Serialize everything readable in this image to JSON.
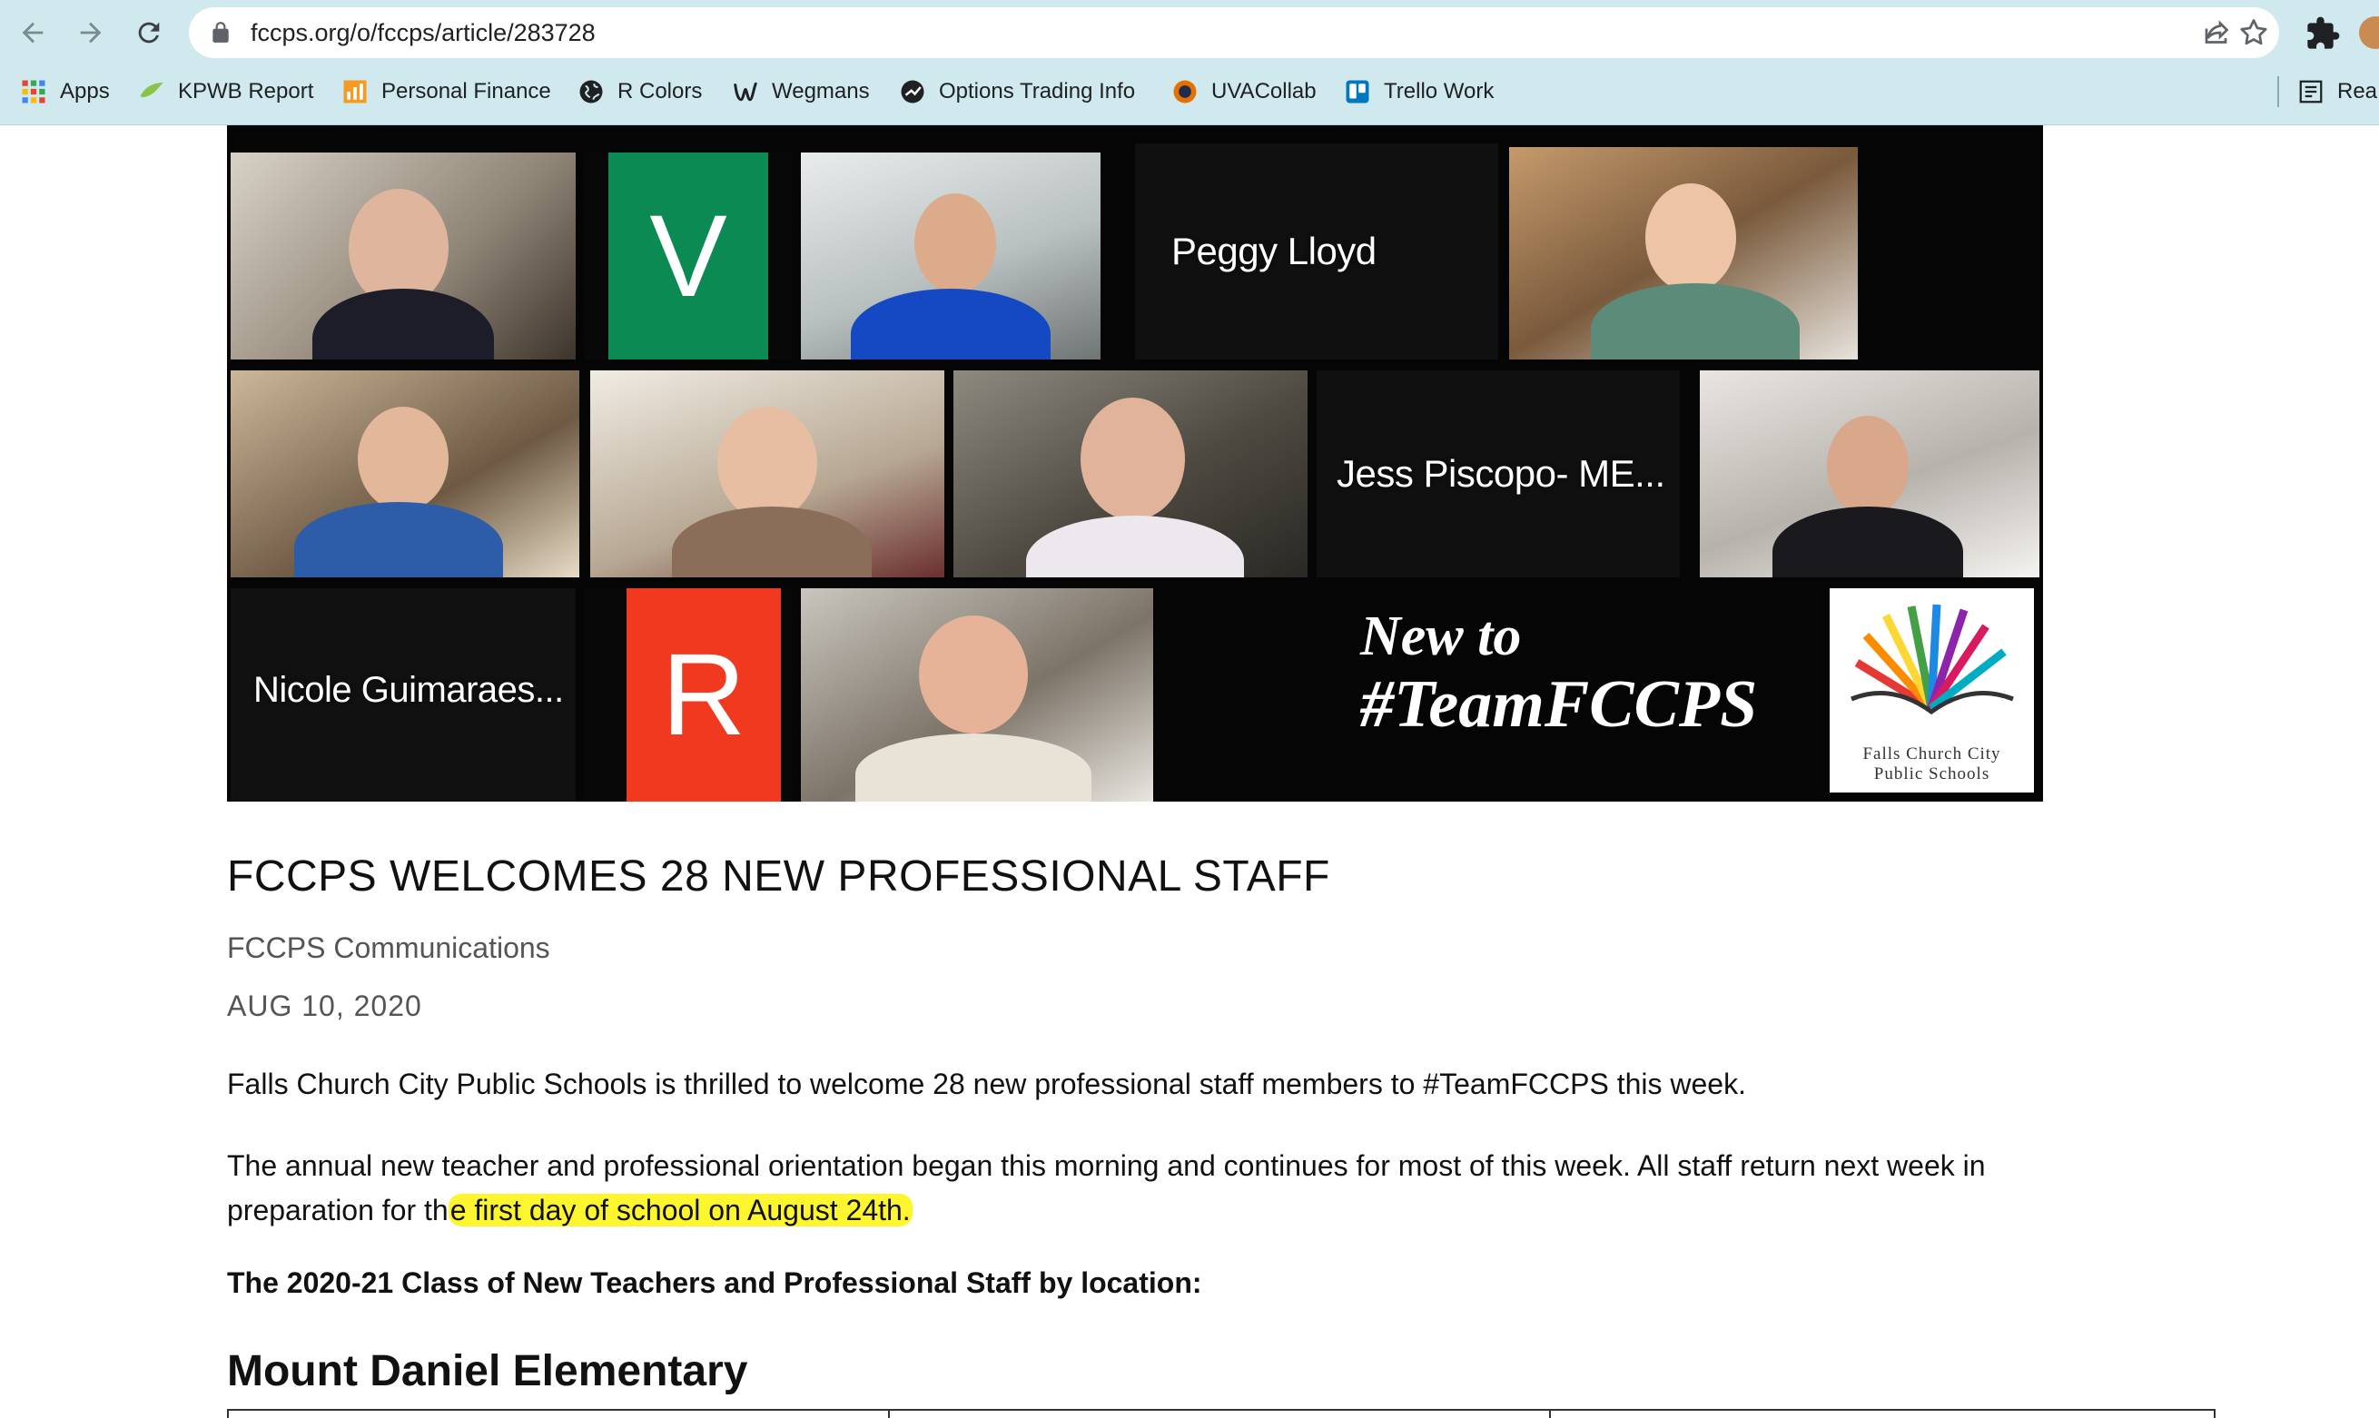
{
  "browser": {
    "url": "fccps.org/o/fccps/article/283728",
    "bookmarks": [
      {
        "label": "Apps",
        "icon": "apps-grid-icon"
      },
      {
        "label": "KPWB Report",
        "icon": "kpwb-icon"
      },
      {
        "label": "Personal Finance",
        "icon": "personal-finance-icon"
      },
      {
        "label": "R Colors",
        "icon": "globe-icon"
      },
      {
        "label": "Wegmans",
        "icon": "wegmans-icon"
      },
      {
        "label": "Options Trading Info",
        "icon": "options-icon"
      },
      {
        "label": "UVACollab",
        "icon": "uvacollab-icon"
      },
      {
        "label": "Trello Work",
        "icon": "trello-icon"
      },
      {
        "label": "Rea",
        "icon": "reading-list-icon"
      }
    ]
  },
  "hero": {
    "names": {
      "peggy": "Peggy Lloyd",
      "jess": "Jess Piscopo- ME...",
      "nicole": "Nicole Guimaraes..."
    },
    "letters": {
      "v": "V",
      "r": "R"
    },
    "caption_line1": "New to",
    "caption_line2": "#TeamFCCPS",
    "logo_line1": "Falls Church City",
    "logo_line2": "Public Schools",
    "colors": {
      "green_tile": "#0b8a54",
      "red_tile": "#f0391e"
    }
  },
  "article": {
    "title": "FCCPS WELCOMES 28 NEW PROFESSIONAL STAFF",
    "author": "FCCPS Communications",
    "date": "AUG 10, 2020",
    "p1": "Falls Church City Public Schools is thrilled to welcome 28 new professional staff members to #TeamFCCPS this week.",
    "p2_before": "The annual new teacher and professional orientation began this morning and continues for most of this week. All staff return next week in preparation for th",
    "p2_highlight": "e first day of school on August 24th.",
    "p3": "The 2020-21 Class of New Teachers and Professional Staff by location:",
    "h2": "Mount Daniel Elementary",
    "highlight_color": "#fdf52e"
  }
}
